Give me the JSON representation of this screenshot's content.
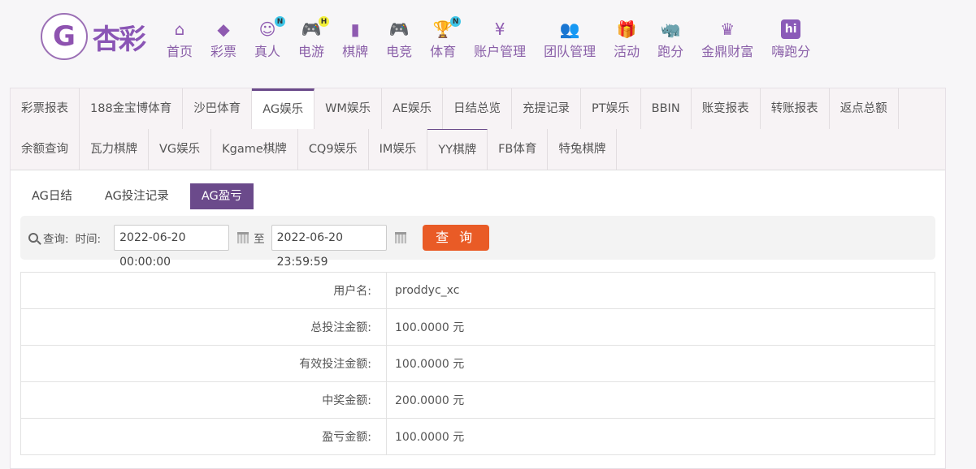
{
  "logo": {
    "mark": "G",
    "text": "杏彩"
  },
  "nav": [
    {
      "label": "首页",
      "icon": "home-icon",
      "glyph": "⌂"
    },
    {
      "label": "彩票",
      "icon": "ticket-icon",
      "glyph": "◆"
    },
    {
      "label": "真人",
      "icon": "dealer-icon",
      "glyph": "☺",
      "badge": "N",
      "badge_color": "#3ec6e8"
    },
    {
      "label": "电游",
      "icon": "gamepad-icon",
      "glyph": "🎮",
      "badge": "H",
      "badge_color": "#f3f03a"
    },
    {
      "label": "棋牌",
      "icon": "cards-icon",
      "glyph": "▮"
    },
    {
      "label": "电竞",
      "icon": "gamepad-icon",
      "glyph": "🎮"
    },
    {
      "label": "体育",
      "icon": "trophy-icon",
      "glyph": "🏆",
      "badge": "N",
      "badge_color": "#3ec6e8"
    },
    {
      "label": "账户管理",
      "icon": "yen-icon",
      "glyph": "¥"
    },
    {
      "label": "团队管理",
      "icon": "team-icon",
      "glyph": "👥"
    },
    {
      "label": "活动",
      "icon": "gift-icon",
      "glyph": "🎁"
    },
    {
      "label": "跑分",
      "icon": "rhino-icon",
      "glyph": "🦏"
    },
    {
      "label": "金鼎财富",
      "icon": "throne-icon",
      "glyph": "♛"
    },
    {
      "label": "嗨跑分",
      "icon": "hi-icon",
      "glyph": "hi"
    }
  ],
  "tabs_row1": [
    "彩票报表",
    "188金宝博体育",
    "沙巴体育",
    "AG娱乐",
    "WM娱乐",
    "AE娱乐",
    "日结总览",
    "充提记录",
    "PT娱乐",
    "BBIN",
    "账变报表",
    "转账报表",
    "返点总额"
  ],
  "tabs_row2": [
    "余额查询",
    "瓦力棋牌",
    "VG娱乐",
    "Kgame棋牌",
    "CQ9娱乐",
    "IM娱乐",
    "YY棋牌",
    "FB体育",
    "特兔棋牌"
  ],
  "active_tab": "AG娱乐",
  "subtabs": [
    "AG日结",
    "AG投注记录",
    "AG盈亏"
  ],
  "active_subtab": "AG盈亏",
  "query": {
    "label": "查询:",
    "time_label": "时间:",
    "start": "2022-06-20 00:00:00",
    "to": "至",
    "end": "2022-06-20 23:59:59",
    "button": "查 询"
  },
  "rows": [
    {
      "label": "用户名:",
      "value": "proddyc_xc"
    },
    {
      "label": "总投注金额:",
      "value": "100.0000 元"
    },
    {
      "label": "有效投注金额:",
      "value": "100.0000 元"
    },
    {
      "label": "中奖金额:",
      "value": "200.0000 元"
    },
    {
      "label": "盈亏金额:",
      "value": "100.0000 元"
    }
  ],
  "colors": {
    "accent": "#6b4a8b",
    "button": "#e95b26",
    "nav": "#8a5fa8"
  }
}
